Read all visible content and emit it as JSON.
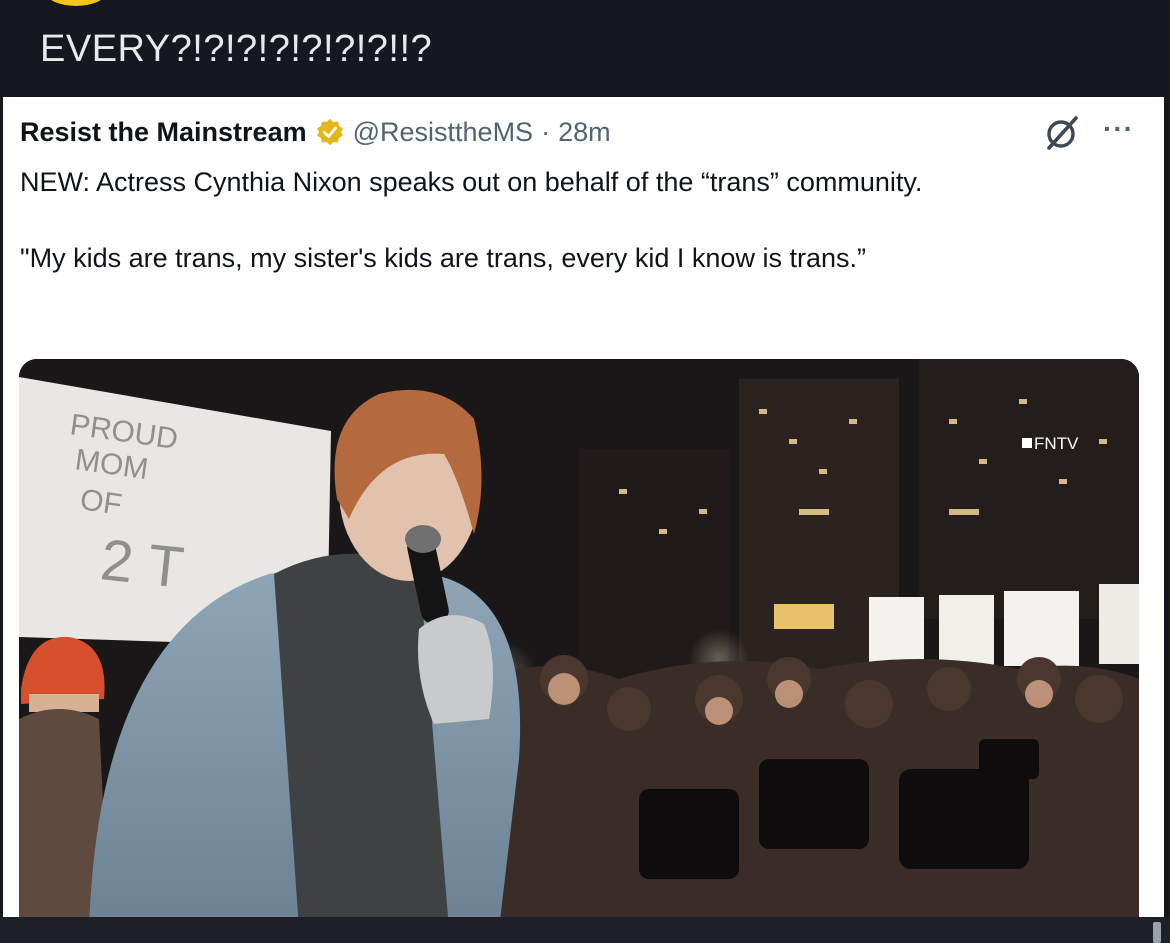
{
  "post": {
    "text": "EVERY?!?!?!?!?!?!?!!?"
  },
  "tweet": {
    "name": "Resist the Mainstream",
    "handle": "@ResisttheMS",
    "separator": "·",
    "time": "28m",
    "body_line1": "NEW: Actress Cynthia Nixon speaks out on behalf of the “trans” community.",
    "quote": "\"My kids are trans, my sister's kids are trans, every kid I know is trans.”",
    "more": "···",
    "verified_color": "#e2b719"
  },
  "media": {
    "sign_text": [
      "PROUD",
      "MOM",
      "OF",
      "2 T"
    ],
    "watermark": "FNTV"
  }
}
